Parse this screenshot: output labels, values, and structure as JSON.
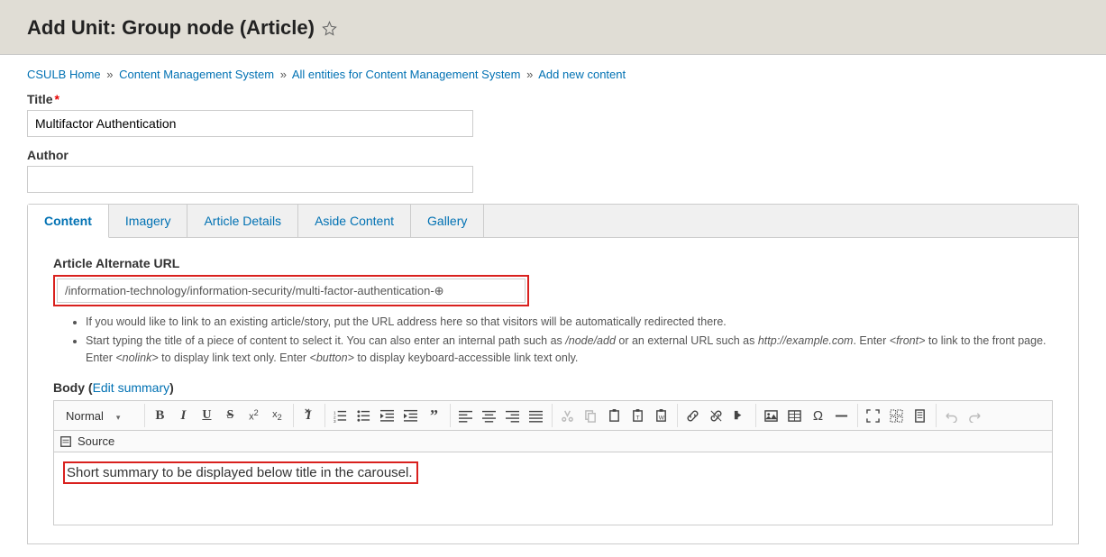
{
  "header": {
    "title": "Add Unit: Group node (Article)"
  },
  "breadcrumb": [
    {
      "label": "CSULB Home"
    },
    {
      "label": "Content Management System"
    },
    {
      "label": "All entities for Content Management System"
    },
    {
      "label": "Add new content"
    }
  ],
  "fields": {
    "title_label": "Title",
    "title_value": "Multifactor Authentication",
    "author_label": "Author",
    "author_value": ""
  },
  "tabs": [
    {
      "label": "Content",
      "active": true
    },
    {
      "label": "Imagery"
    },
    {
      "label": "Article Details"
    },
    {
      "label": "Aside Content"
    },
    {
      "label": "Gallery"
    }
  ],
  "content": {
    "alt_url_label": "Article Alternate URL",
    "alt_url_value": "/information-technology/information-security/multi-factor-authentication-⊕",
    "help1": "If you would like to link to an existing article/story, put the URL address here so that visitors will be automatically redirected there.",
    "help2_a": "Start typing the title of a piece of content to select it. You can also enter an internal path such as ",
    "help2_i1": "/node/add",
    "help2_b": " or an external URL such as ",
    "help2_i2": "http://example.com",
    "help2_c": ". Enter ",
    "help2_i3": "<front>",
    "help2_d": " to link to the front page. Enter ",
    "help2_i4": "<nolink>",
    "help2_e": " to display link text only. Enter ",
    "help2_i5": "<button>",
    "help2_f": " to display keyboard-accessible link text only.",
    "body_label": "Body (",
    "edit_summary": "Edit summary",
    "body_close": ")",
    "format_option": "Normal",
    "source_label": "Source",
    "summary_text": "Short summary to be displayed below title in the carousel."
  }
}
